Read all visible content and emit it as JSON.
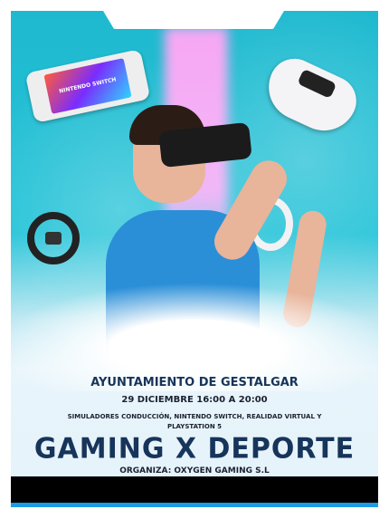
{
  "poster": {
    "device_logo": "NINTENDO SWITCH",
    "organizer_line": "AYUNTAMIENTO DE GESTALGAR",
    "date_time": "29 DICIEMBRE 16:00 A 20:00",
    "activities": "SIMULADORES CONDUCCIÓN, NINTENDO SWITCH, REALIDAD VIRTUAL Y PLAYSTATION 5",
    "title": "GAMING X DEPORTE",
    "organized_by": "ORGANIZA: OXYGEN GAMING S.L"
  },
  "colors": {
    "title": "#17345a",
    "accent": "#1e9be8",
    "background": "#22c3d8",
    "beam": "#f2b7f7"
  }
}
